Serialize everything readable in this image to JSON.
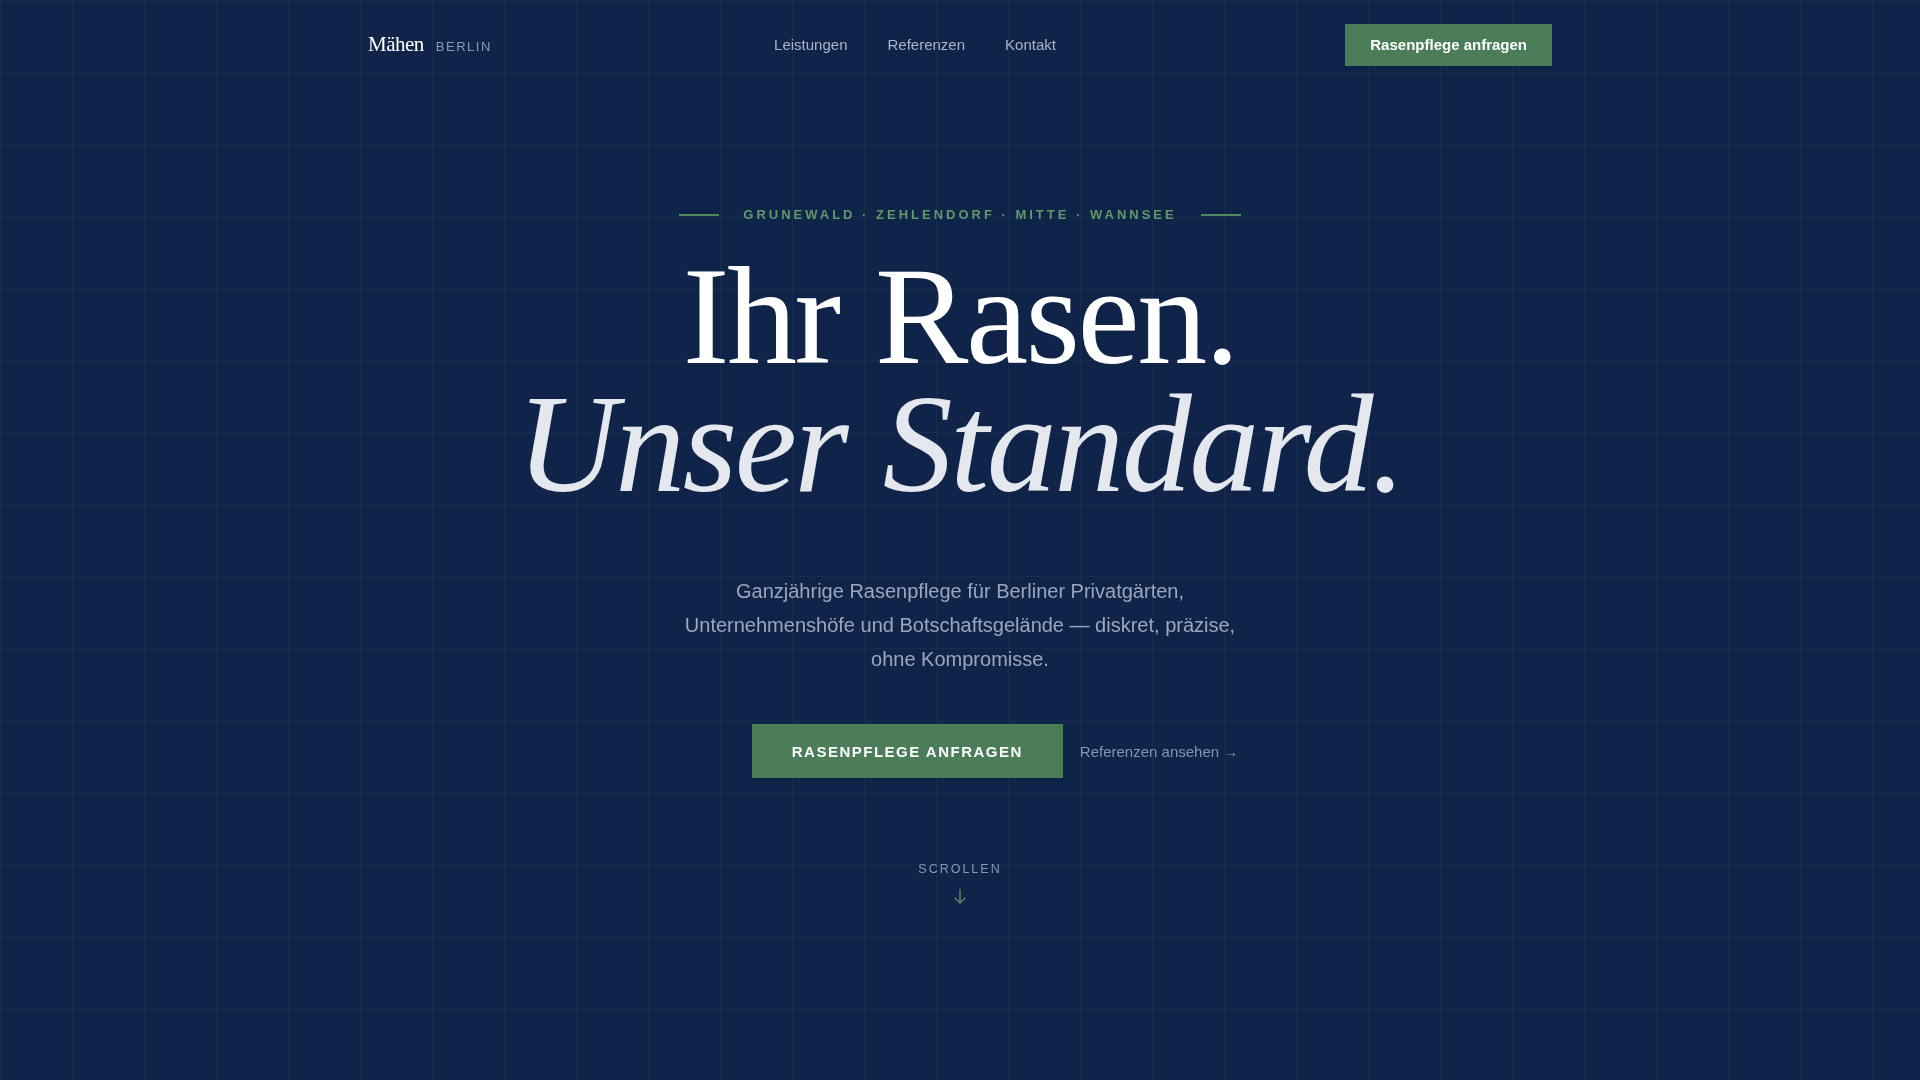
{
  "header": {
    "logo": "Mähen",
    "logo_suffix": "BERLIN",
    "nav": [
      "Leistungen",
      "Referenzen",
      "Kontakt"
    ],
    "cta": "Rasenpflege anfragen"
  },
  "hero": {
    "eyebrow": "GRUNEWALD · ZEHLENDORF · MITTE · WANNSEE",
    "title_line_1": "Ihr Rasen.",
    "title_line_2": "Unser Standard.",
    "lead": "Ganzjährige Rasenpflege für Berliner Privatgärten, Unternehmenshöfe und Botschaftsgelände — diskret, präzise, ohne Kompromisse.",
    "primary_button": "RASENPFLEGE ANFRAGEN",
    "secondary_link": "Referenzen ansehen →",
    "scroll_label": "SCROLLEN"
  }
}
